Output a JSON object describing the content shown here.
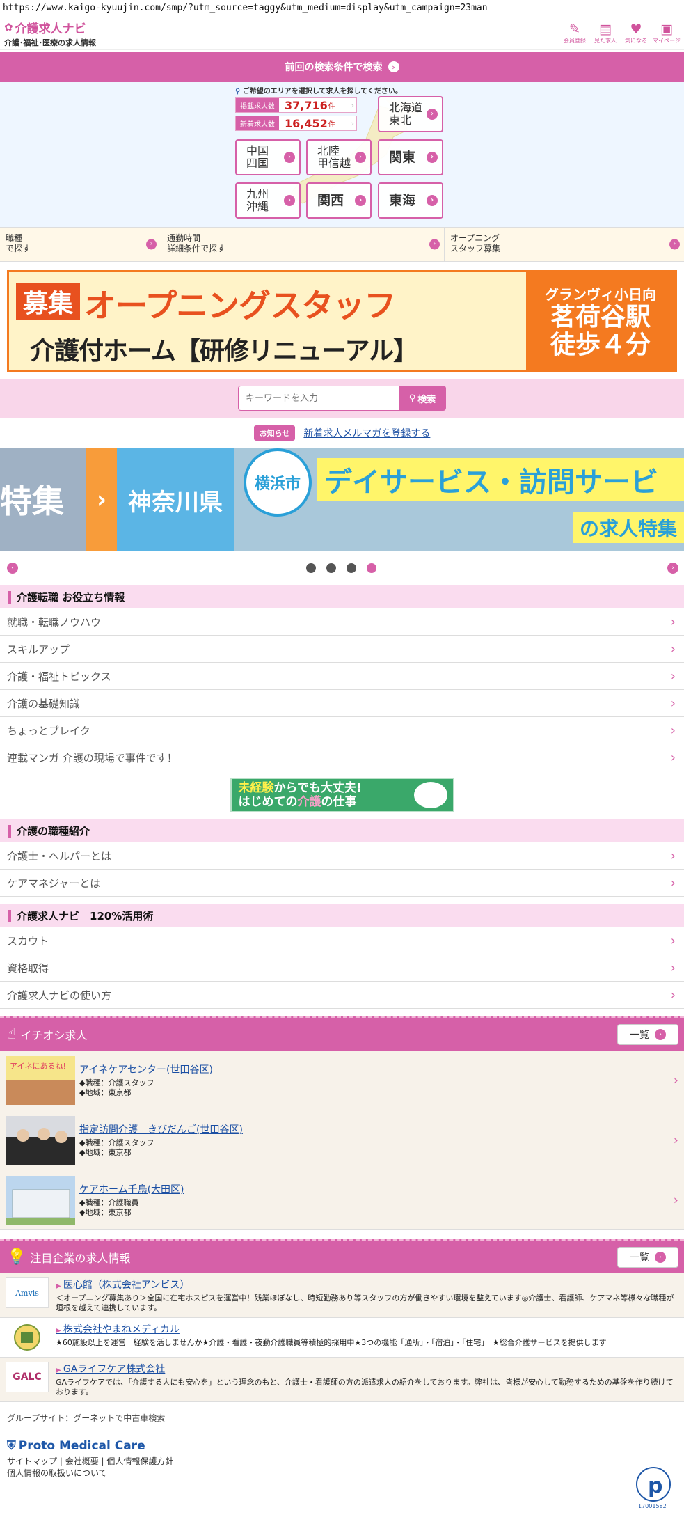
{
  "url": "https://www.kaigo-kyuujin.com/smp/?utm_source=taggy&utm_medium=display&utm_campaign=23man",
  "header": {
    "logo_main": "介護求人ナビ",
    "logo_sub": "介護･福祉･医療の求人情報",
    "icons": [
      {
        "label": "会員登録",
        "icon": "pen-icon"
      },
      {
        "label": "見た求人",
        "icon": "history-icon"
      },
      {
        "label": "気になる",
        "icon": "heart-icon"
      },
      {
        "label": "マイページ",
        "icon": "mypage-icon"
      }
    ]
  },
  "prev_search": "前回の検索条件で検索",
  "area": {
    "hint": "ご希望のエリアを選択して求人を探してください。",
    "counts": [
      {
        "label": "掲載求人数",
        "value": "37,716",
        "unit": "件"
      },
      {
        "label": "新着求人数",
        "value": "16,452",
        "unit": "件"
      }
    ],
    "regions": {
      "hokkaido": "北海道\n東北",
      "chugoku": "中国\n四国",
      "hokuriku": "北陸\n甲信越",
      "kanto": "関東",
      "kyushu": "九州\n沖縄",
      "kansai": "関西",
      "tokai": "東海"
    }
  },
  "filters": [
    {
      "label": "職種\nで探す"
    },
    {
      "label": "通勤時間\n詳細条件で探す"
    },
    {
      "label": "オープニング\nスタッフ募集"
    }
  ],
  "banner": {
    "tag": "募集",
    "title1": "オープニングスタッフ",
    "title2": "介護付ホーム【研修リニューアル】",
    "right1": "グランヴィ小日向",
    "right2": "茗荷谷駅",
    "right3": "徒歩４分"
  },
  "search": {
    "placeholder": "キーワードを入力",
    "button": "検索"
  },
  "notice": {
    "badge": "お知らせ",
    "link": "新着求人メルマガを登録する"
  },
  "hero": {
    "tokushu": "特集",
    "arrow": "›",
    "pref": "神奈川県",
    "city": "横浜市",
    "headline": "デイサービス・訪問サービ",
    "sub": "の求人特集"
  },
  "pager": {
    "active": 3,
    "count": 4
  },
  "sections": [
    {
      "title": "介護転職 お役立ち情報",
      "items": [
        "就職・転職ノウハウ",
        "スキルアップ",
        "介護・福祉トピックス",
        "介護の基礎知識",
        "ちょっとブレイク",
        "連載マンガ 介護の現場で事件です！"
      ]
    },
    {
      "title": "介護の職種紹介",
      "items": [
        "介護士・ヘルパーとは",
        "ケアマネジャーとは"
      ]
    },
    {
      "title": "介護求人ナビ　120%活用術",
      "items": [
        "スカウト",
        "資格取得",
        "介護求人ナビの使い方"
      ]
    }
  ],
  "mid_banner": {
    "line1a": "未経験",
    "line1b": "からでも大丈夫!",
    "line2a": "はじめての",
    "line2b": "介護",
    "line2c": "の仕事"
  },
  "pickup": {
    "title": "イチオシ求人",
    "more": "一覧",
    "jobs": [
      {
        "title": "アイネケアセンター(世田谷区)",
        "job": "◆職種：介護スタッフ",
        "area": "◆地域：東京都"
      },
      {
        "title": "指定訪問介護　きびだんご(世田谷区)",
        "job": "◆職種：介護スタッフ",
        "area": "◆地域：東京都"
      },
      {
        "title": "ケアホーム千鳥(大田区)",
        "job": "◆職種：介護職員",
        "area": "◆地域：東京都"
      }
    ]
  },
  "companies": {
    "title": "注目企業の求人情報",
    "more": "一覧",
    "items": [
      {
        "logo": "Amvis",
        "title": "医心館（株式会社アンビス）",
        "desc": "＜オープニング募集あり＞全国に在宅ホスピスを運営中！残業ほぼなし、時短勤務あり等スタッフの方が働きやすい環境を整えています◎介護士、看護師、ケアマネ等様々な職種が垣根を越えて連携しています。"
      },
      {
        "logo": "",
        "title": "株式会社やまねメディカル",
        "desc": "★60施設以上を運営　経験を活しませんか★介護・看護・夜勤介護職員等積極的採用中★3つの機能「通所」・「宿泊」・「住宅」　★総合介護サービスを提供します"
      },
      {
        "logo": "GALC",
        "title": "GAライフケア株式会社",
        "desc": "GAライフケアでは、「介護する人にも安心を」という理念のもと、介護士・看護師の方の派遣求人の紹介をしております。弊社は、皆様が安心して勤務するための基盤を作り続けております。"
      }
    ]
  },
  "footer": {
    "group_label": "グループサイト：",
    "group_link": "グーネットで中古車検索",
    "company": "Proto Medical Care",
    "links": [
      "サイトマップ",
      "会社概要",
      "個人情報保護方針",
      "個人情報の取扱いについて"
    ],
    "pmark_no": "17001582"
  },
  "colors": {
    "accent": "#d660a8",
    "link": "#1b4fa3",
    "banner": "#f47a20"
  }
}
